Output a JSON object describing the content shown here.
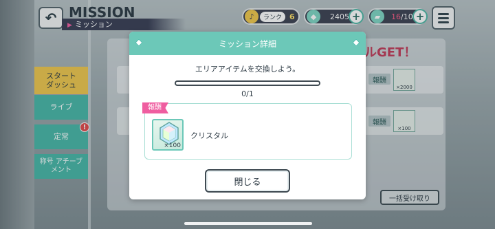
{
  "header": {
    "title": "MISSION",
    "subtitle": "ミッション"
  },
  "status": {
    "rank_label": "ランク",
    "rank_value": "6",
    "crystal_count": "2405",
    "stamina_current": "16",
    "stamina_max": "/10"
  },
  "side_tabs": {
    "start_dash": "スタート ダッシュ",
    "live": "ライブ",
    "regular": "定常",
    "title_achievement": "称号 アチーブメント",
    "notice_badge": "!"
  },
  "background": {
    "banner_text": "ルGET！",
    "rows": [
      {
        "reward_label": "報酬",
        "reward_qty": "×2000"
      },
      {
        "reward_label": "報酬",
        "reward_qty": "×100"
      }
    ],
    "bulk_receive_label": "一括受け取り"
  },
  "modal": {
    "title": "ミッション詳細",
    "description": "エリアアイテムを交換しよう。",
    "progress_fraction": 0,
    "progress_text": "0/1",
    "reward_label": "報酬",
    "reward_item_name": "クリスタル",
    "reward_item_qty": "×100",
    "reward_icon": "crystal-icon",
    "close_label": "閉じる"
  },
  "colors": {
    "accent_teal": "#6cc8b8",
    "accent_pink": "#ef5ea0",
    "tab_yellow": "#efc74d"
  }
}
